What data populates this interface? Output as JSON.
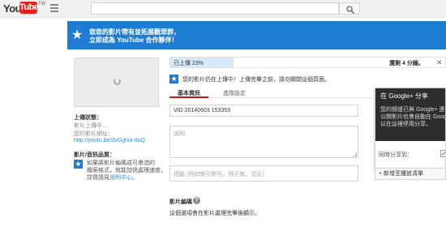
{
  "header": {
    "logo_you": "You",
    "logo_tube": "Tube",
    "logo_region": "TW",
    "search": {
      "placeholder": ""
    }
  },
  "banner": {
    "line1": "您您的影片帶有並拓展觀眾群，",
    "line2": "立即成為 YouTube 合作夥伴！"
  },
  "sidebar": {
    "upload_status_label": "上傳狀態：",
    "upload_status_value": "影片上傳中...",
    "video_url_label": "您的影片網址：",
    "video_url": "http://youtu.be/dvGghia-duQ",
    "info_label": "影片/音訊品質：",
    "info_text1": "如果將影片編碼成可串流的",
    "info_text2": "檔案格式，就能加快處理速度，",
    "info_text3_prefix": "詳情請見",
    "info_link": "說明中心",
    "info_text3_suffix": "。"
  },
  "upload": {
    "progress_label": "已上傳 23%",
    "progress": 23,
    "remaining": "還剩 4 分鐘。",
    "close_icon": "close-icon"
  },
  "notice": {
    "text": "您的影片仍在上傳中！上傳完畢之前，請勿關閉這個頁面。"
  },
  "tabs": [
    {
      "label": "基本資訊"
    },
    {
      "label": "進階設定"
    }
  ],
  "form": {
    "title_value": "VID 20140603 153353",
    "description_placeholder": "說明",
    "tags_placeholder": "標籤 (例如變形斯坦、飛天豬、混反)",
    "category_label": "影片編碼",
    "category_note": "這個選項會在影片處理完畢後顯示。"
  },
  "gplus": {
    "title": "在 Google+ 分享",
    "text1": "您的頻道已與 Google+ 連",
    "text2": "公開影片也會自動在 Goog",
    "text3": "以在這裡停用分享。",
    "share_label": "同時分享到：",
    "share_checked": "✓"
  },
  "playlist_button": "+ 新增至播放清單",
  "colors": {
    "youtube_red": "#e62117",
    "banner_blue": "#1e7dd2",
    "link_blue": "#2793e6",
    "tab_underline": "#cc181e"
  }
}
